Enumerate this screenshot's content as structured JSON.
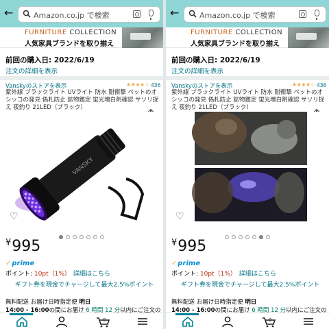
{
  "search": {
    "placeholder": "Amazon.co.jp で検索"
  },
  "banner": {
    "headline_a": "FURNITURE",
    "headline_b": "COLLECTION",
    "subtitle": "人気家具ブランドを取り揃え"
  },
  "purchase": {
    "last_purchase": "前回の購入日: 2022/6/19",
    "order_details_link": "注文の詳細を表示"
  },
  "product": {
    "store_link": "Vanskyのストアを表示",
    "stars": "★★★★☆",
    "rating_count": "436",
    "title": "紫外線 ブラックライト UVライト 防水 耐衝撃 ペットのオシッコの発見 偽札防止 鉱物鑑定 蛍光増白剤確認 サソリ捉え 夜釣り 21LED（ブラック）",
    "flashlight_brand": "VANSKY",
    "price_symbol": "¥",
    "price_value": "995",
    "prime_label": "prime",
    "points_label": "ポイント: ",
    "points_value": "10pt（1%）",
    "points_details_link": "詳細はこちら",
    "gift_card_text": "ギフト券を現金でチャージして最大2.5%ポイント",
    "shipping_line1_a": "無料配送 お届け日時指定便 ",
    "shipping_line1_b": "明日",
    "shipping_time": "14:00 - 16:00",
    "shipping_line2_a": "の間にお届け ",
    "shipping_countdown": "6 時間 12 分",
    "shipping_line2_b": "以内にご注文の"
  },
  "carousel": {
    "left_active": 0,
    "right_active": 5,
    "count": 7
  },
  "colors": {
    "header_bg": "#8fd6d6",
    "link": "#007185",
    "price_red": "#b12704",
    "prime_blue": "#0a8bd6",
    "star": "#f3a847"
  },
  "icons": [
    "back-arrow-icon",
    "search-icon",
    "camera-icon",
    "microphone-icon",
    "share-icon",
    "heart-icon",
    "home-icon",
    "account-icon",
    "cart-icon",
    "menu-icon"
  ]
}
